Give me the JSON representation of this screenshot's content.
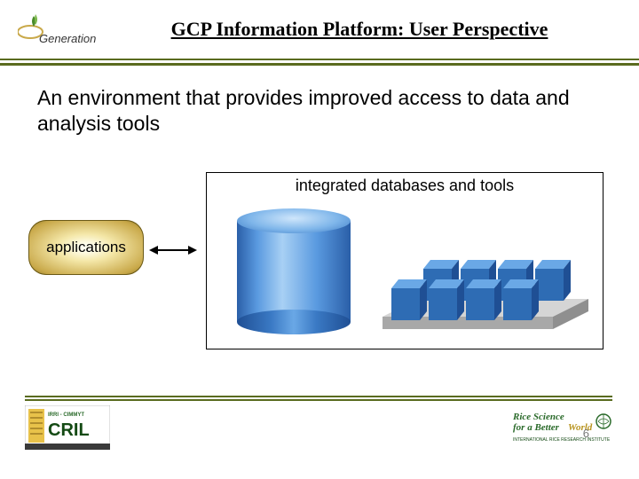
{
  "header": {
    "logo_text": "Generation",
    "title": "GCP Information Platform: User Perspective"
  },
  "body": {
    "headline": "An environment that provides improved access to data and analysis tools"
  },
  "diagram": {
    "applications_label": "applications",
    "databases_label": "integrated databases and tools"
  },
  "footer": {
    "left_logo_top": "IRRI - CIMMYT",
    "left_logo_main": "CRIL",
    "right_logo_line1": "Rice Science",
    "right_logo_line2": "for a Better World",
    "right_logo_line3": "INTERNATIONAL RICE RESEARCH INSTITUTE",
    "page_number": "6"
  },
  "colors": {
    "accent_olive": "#5a6b1f",
    "db_blue": "#3a79c4"
  }
}
